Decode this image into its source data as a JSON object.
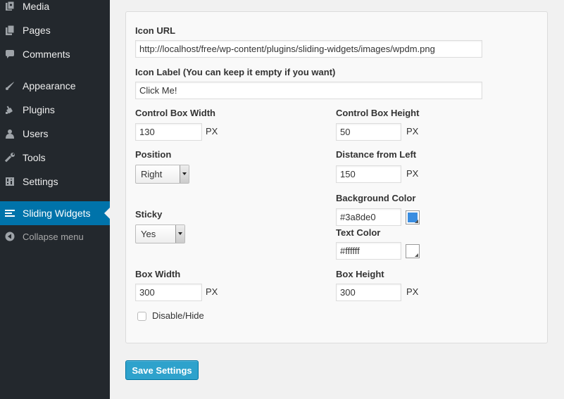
{
  "sidebar": {
    "items": [
      {
        "label": "Media",
        "icon": "media-icon"
      },
      {
        "label": "Pages",
        "icon": "pages-icon"
      },
      {
        "label": "Comments",
        "icon": "comments-icon"
      },
      {
        "label": "Appearance",
        "icon": "appearance-icon"
      },
      {
        "label": "Plugins",
        "icon": "plugins-icon"
      },
      {
        "label": "Users",
        "icon": "users-icon"
      },
      {
        "label": "Tools",
        "icon": "tools-icon"
      },
      {
        "label": "Settings",
        "icon": "settings-icon"
      },
      {
        "label": "Sliding Widgets",
        "icon": "sliding-widgets-icon",
        "active": true
      }
    ],
    "collapse_label": "Collapse menu"
  },
  "form": {
    "icon_url_label": "Icon URL",
    "icon_url_value": "http://localhost/free/wp-content/plugins/sliding-widgets/images/wpdm.png",
    "icon_label_label": "Icon Label (You can keep it empty if you want)",
    "icon_label_value": "Click Me!",
    "control_box_width_label": "Control Box Width",
    "control_box_width_value": "130",
    "control_box_height_label": "Control Box Height",
    "control_box_height_value": "50",
    "position_label": "Position",
    "position_value": "Right",
    "distance_left_label": "Distance from Left",
    "distance_left_value": "150",
    "background_color_label": "Background Color",
    "background_color_value": "#3a8de0",
    "sticky_label": "Sticky",
    "sticky_value": "Yes",
    "text_color_label": "Text Color",
    "text_color_value": "#ffffff",
    "box_width_label": "Box Width",
    "box_width_value": "300",
    "box_height_label": "Box Height",
    "box_height_value": "300",
    "disable_label": "Disable/Hide",
    "disable_checked": false,
    "unit": "PX"
  },
  "save_label": "Save Settings",
  "colors": {
    "sidebar_bg": "#23282d",
    "active_bg": "#0073aa",
    "button_bg": "#2ea2cc",
    "background_swatch": "#3a8de0",
    "text_swatch": "#ffffff"
  }
}
